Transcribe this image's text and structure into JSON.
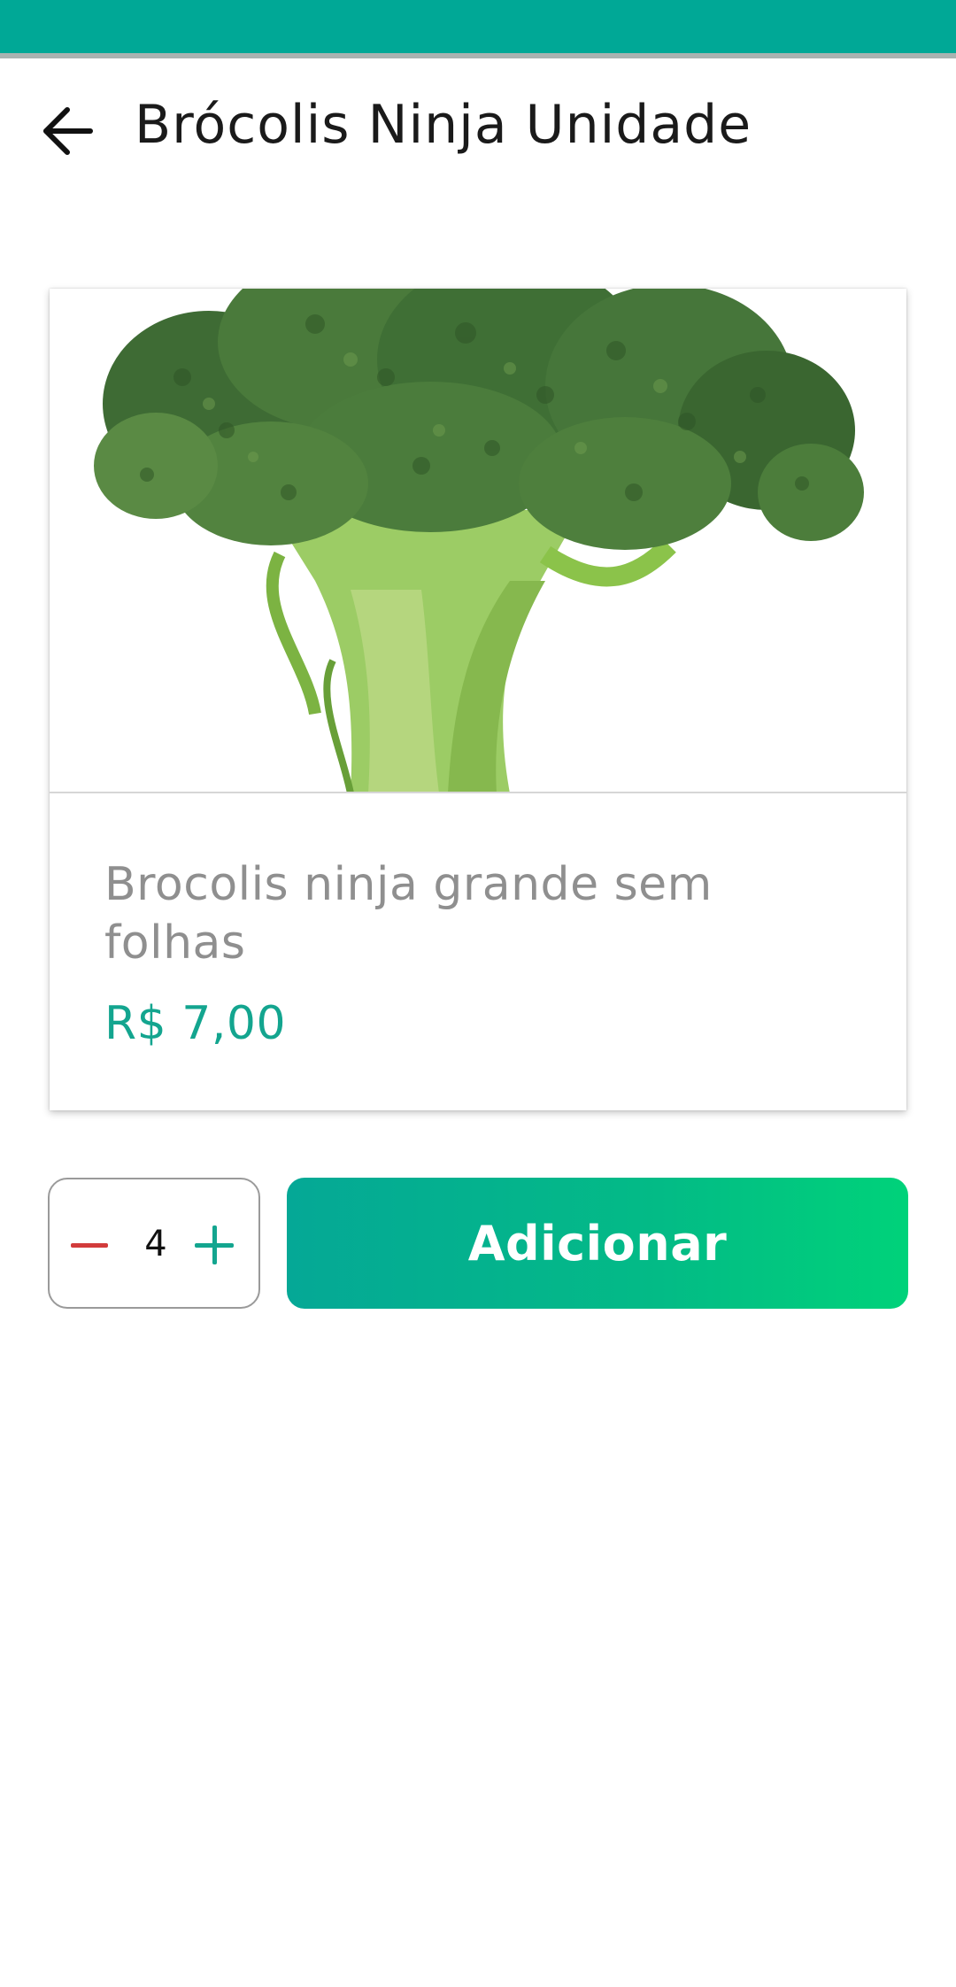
{
  "header": {
    "title": "Brócolis Ninja Unidade",
    "back_icon": "arrow-left-icon"
  },
  "product": {
    "image": "broccoli-photo",
    "description": "Brocolis ninja grande sem folhas",
    "price": "R$ 7,00"
  },
  "quantity": {
    "value": "4",
    "decrement_icon": "minus-icon",
    "increment_icon": "plus-icon"
  },
  "actions": {
    "add_label": "Adicionar"
  },
  "colors": {
    "status_bar": "#00a896",
    "price": "#13a58f",
    "minus": "#d23b3b",
    "plus": "#13a58f",
    "button_gradient_start": "#05a896",
    "button_gradient_end": "#00d27a"
  }
}
